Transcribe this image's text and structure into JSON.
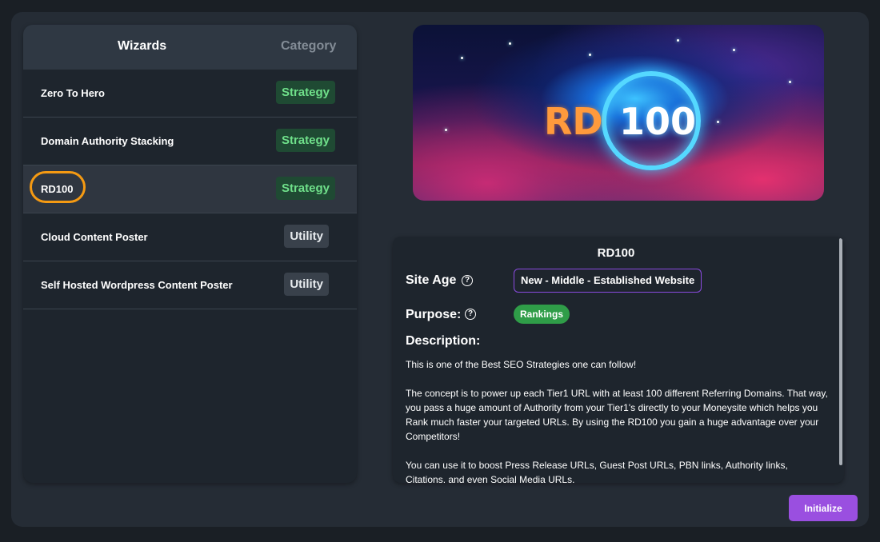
{
  "wizards_table": {
    "header_wizards": "Wizards",
    "header_category": "Category",
    "rows": [
      {
        "name": "Zero To Hero",
        "category": "Strategy"
      },
      {
        "name": "Domain Authority Stacking",
        "category": "Strategy"
      },
      {
        "name": "RD100",
        "category": "Strategy",
        "selected": true
      },
      {
        "name": "Cloud Content Poster",
        "category": "Utility"
      },
      {
        "name": "Self Hosted Wordpress Content Poster",
        "category": "Utility"
      }
    ]
  },
  "banner": {
    "text_rd": "RD",
    "text_100": "100"
  },
  "details": {
    "title": "RD100",
    "site_age_label": "Site Age",
    "site_age_value": "New - Middle - Established Website",
    "purpose_label": "Purpose:",
    "purpose_value": "Rankings",
    "description_label": "Description:",
    "description_paragraphs": [
      "This is one of the Best SEO Strategies one can follow!",
      "The concept is to power up each Tier1 URL with at least 100 different Referring Domains. That way, you pass a huge amount of Authority from your Tier1's directly to your Moneysite which helps you Rank much faster your targeted URLs. By using the RD100 you gain a huge advantage over your Competitors!",
      "You can use it to boost Press Release URLs, Guest Post URLs, PBN links, Authority links, Citations, and even Social Media URLs."
    ],
    "help_icon_glyph": "?"
  },
  "actions": {
    "initialize_label": "Initialize"
  },
  "colors": {
    "strategy_tag_bg": "#1f4a33",
    "strategy_tag_text": "#6fe08a",
    "utility_tag_bg": "#39414b",
    "accent_purple": "#9a4fe0",
    "purpose_green": "#2f9d48",
    "selection_ring": "#f59a12"
  }
}
